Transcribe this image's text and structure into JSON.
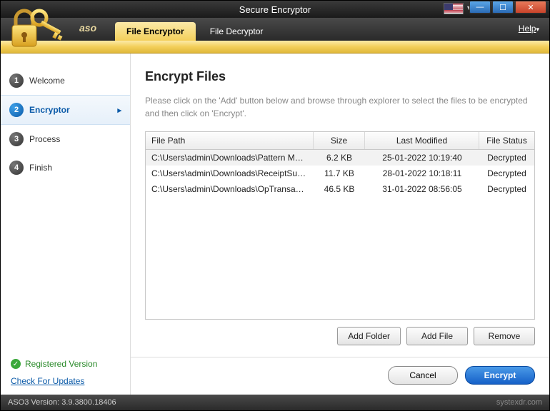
{
  "window": {
    "title": "Secure Encryptor"
  },
  "brand": "aso",
  "tabs": [
    {
      "label": "File Encryptor",
      "active": true
    },
    {
      "label": "File Decryptor",
      "active": false
    }
  ],
  "help_label": "Help",
  "sidebar": {
    "steps": [
      {
        "num": "1",
        "label": "Welcome"
      },
      {
        "num": "2",
        "label": "Encryptor"
      },
      {
        "num": "3",
        "label": "Process"
      },
      {
        "num": "4",
        "label": "Finish"
      }
    ],
    "active_index": 1,
    "registered_label": "Registered Version",
    "updates_label": "Check For Updates"
  },
  "main": {
    "heading": "Encrypt Files",
    "description": "Please click on the 'Add' button below and browse through explorer to select the files to be encrypted and then click on 'Encrypt'.",
    "columns": {
      "path": "File Path",
      "size": "Size",
      "modified": "Last Modified",
      "status": "File Status"
    },
    "rows": [
      {
        "path": "C:\\Users\\admin\\Downloads\\Pattern Mat...",
        "size": "6.2 KB",
        "modified": "25-01-2022 10:19:40",
        "status": "Decrypted"
      },
      {
        "path": "C:\\Users\\admin\\Downloads\\ReceiptSum...",
        "size": "11.7 KB",
        "modified": "28-01-2022 10:18:11",
        "status": "Decrypted"
      },
      {
        "path": "C:\\Users\\admin\\Downloads\\OpTransacti...",
        "size": "46.5 KB",
        "modified": "31-01-2022 08:56:05",
        "status": "Decrypted"
      }
    ],
    "buttons": {
      "add_folder": "Add Folder",
      "add_file": "Add File",
      "remove": "Remove",
      "cancel": "Cancel",
      "encrypt": "Encrypt"
    }
  },
  "statusbar": {
    "version": "ASO3 Version: 3.9.3800.18406",
    "watermark": "systexdr.com"
  }
}
